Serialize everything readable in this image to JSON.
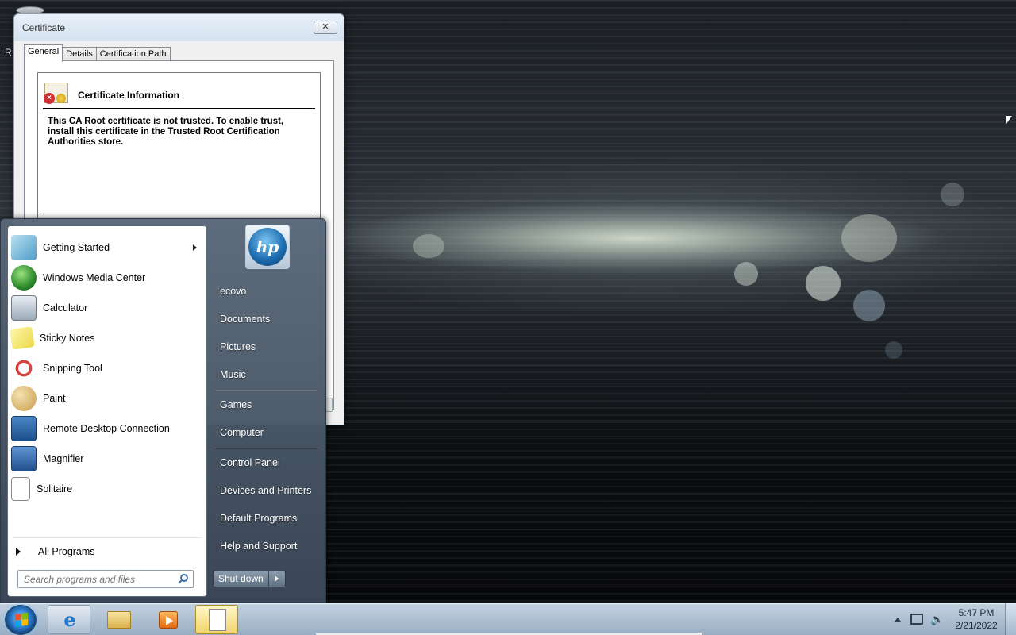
{
  "desktop": {
    "partial_label": "R"
  },
  "certificate_window": {
    "title": "Certificate",
    "close_glyph": "✕",
    "tabs": [
      {
        "label": "General",
        "active": true
      },
      {
        "label": "Details",
        "active": false
      },
      {
        "label": "Certification Path",
        "active": false
      }
    ],
    "info_title": "Certificate Information",
    "info_text": "This CA Root certificate is not trusted. To enable trust, install this certificate in the Trusted Root Certification Authorities store."
  },
  "start_menu": {
    "pinned_programs": [
      {
        "label": "Getting Started",
        "icon": "getting-started-icon",
        "has_submenu": true
      },
      {
        "label": "Windows Media Center",
        "icon": "windows-media-center-icon",
        "has_submenu": false
      },
      {
        "label": "Calculator",
        "icon": "calculator-icon",
        "has_submenu": false
      },
      {
        "label": "Sticky Notes",
        "icon": "sticky-notes-icon",
        "has_submenu": false
      },
      {
        "label": "Snipping Tool",
        "icon": "snipping-tool-icon",
        "has_submenu": false
      },
      {
        "label": "Paint",
        "icon": "paint-icon",
        "has_submenu": false
      },
      {
        "label": "Remote Desktop Connection",
        "icon": "remote-desktop-icon",
        "has_submenu": false
      },
      {
        "label": "Magnifier",
        "icon": "magnifier-icon",
        "has_submenu": false
      },
      {
        "label": "Solitaire",
        "icon": "solitaire-icon",
        "has_submenu": false
      }
    ],
    "all_programs_label": "All Programs",
    "search_placeholder": "Search programs and files",
    "user_tile_logo": "hp",
    "right_items": [
      {
        "label": "ecovo"
      },
      {
        "label": "Documents"
      },
      {
        "label": "Pictures"
      },
      {
        "label": "Music"
      },
      {
        "label": "Games"
      },
      {
        "label": "Computer"
      },
      {
        "label": "Control Panel"
      },
      {
        "label": "Devices and Printers"
      },
      {
        "label": "Default Programs"
      },
      {
        "label": "Help and Support"
      }
    ],
    "shutdown_label": "Shut down"
  },
  "taskbar": {
    "pinned": [
      "internet-explorer-icon",
      "windows-explorer-icon",
      "media-player-icon",
      "notepad-icon"
    ],
    "clock": {
      "time": "5:47 PM",
      "date": "2/21/2022"
    }
  },
  "colors": {
    "start_menu_bg": "#586778",
    "taskbar_bg": "#cddceb",
    "window_frame": "#d7e4f2"
  }
}
